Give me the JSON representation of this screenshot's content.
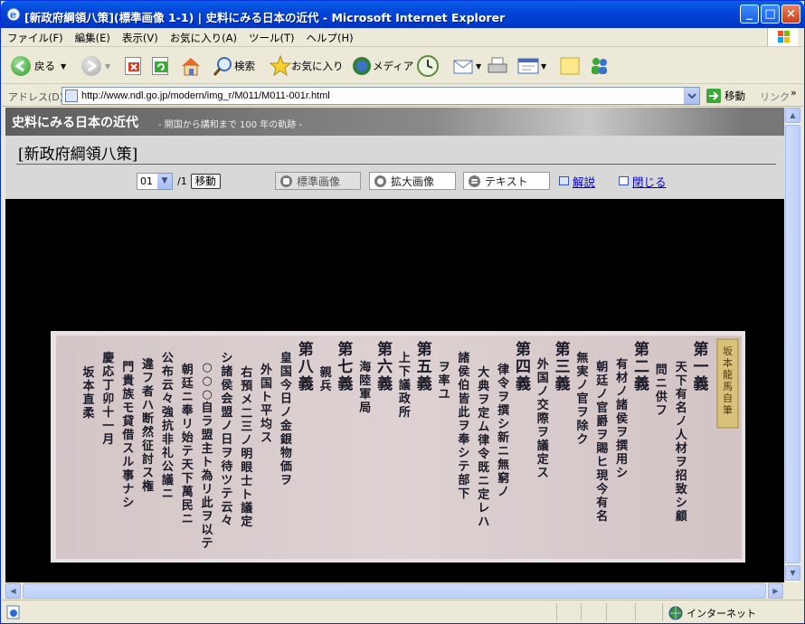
{
  "window": {
    "title": "[新政府綱領八策](標準画像 1-1) | 史料にみる日本の近代 - Microsoft Internet Explorer"
  },
  "menu": [
    "ファイル(F)",
    "編集(E)",
    "表示(V)",
    "お気に入り(A)",
    "ツール(T)",
    "ヘルプ(H)"
  ],
  "toolbar": {
    "back_label": "戻る",
    "search_label": "検索",
    "favorites_label": "お気に入り",
    "media_label": "メディア"
  },
  "address": {
    "label": "アドレス(D)",
    "url": "http://www.ndl.go.jp/modern/img_r/M011/M011-001r.html",
    "go_label": "移動",
    "links_label": "リンク"
  },
  "site": {
    "title": "史料にみる日本の近代",
    "subtitle": "- 開国から講和まで 100 年の軌跡 -"
  },
  "document": {
    "title": "[新政府綱領八策]",
    "page_select_value": "01",
    "page_total": "/1",
    "go_button": "移動",
    "view_standard": "標準画像",
    "view_zoom": "拡大画像",
    "view_text": "テキスト",
    "commentary_link": "解説",
    "close_link": "閉じる"
  },
  "manuscript": {
    "label": "坂本龍馬自筆",
    "columns": [
      "第一義",
      "天下有名ノ人材ヲ招致シ顧",
      "問ニ供フ",
      "第二義",
      "有材ノ諸侯ヲ撰用シ",
      "朝廷ノ官爵ヲ賜ヒ現今有名",
      "無実ノ官ヲ除ク",
      "第三義",
      "外国ノ交際ヲ議定ス",
      "第四義",
      "律令ヲ撰シ新ニ無窮ノ",
      "大典ヲ定ム律令既ニ定レハ",
      "諸侯伯皆此ヲ奉シテ部下",
      "ヲ率ユ",
      "第五義",
      "上下議政所",
      "第六義",
      "海陸軍局",
      "第七義",
      "親兵",
      "第八義",
      "皇国今日ノ金銀物価ヲ",
      "外国ト平均ス",
      "右預メ二三ノ明眼士ト議定",
      "シ諸侯会盟ノ日ヲ待ツテ云々",
      "○○○自ラ盟主ト為リ此ヲ以テ",
      "朝廷ニ奉リ始テ天下萬民ニ",
      "公布云々強抗非礼公議ニ",
      "違フ者ハ断然征討ス権",
      "門貴族モ貸借スル事ナシ",
      "慶応丁卯十一月",
      "坂本直柔"
    ]
  },
  "status": {
    "zone": "インターネット"
  },
  "colors": {
    "titlebar": "#0245d8",
    "paper": "#d9cccd",
    "ink": "#1a1a28",
    "label_strip": "#d8c27a"
  }
}
